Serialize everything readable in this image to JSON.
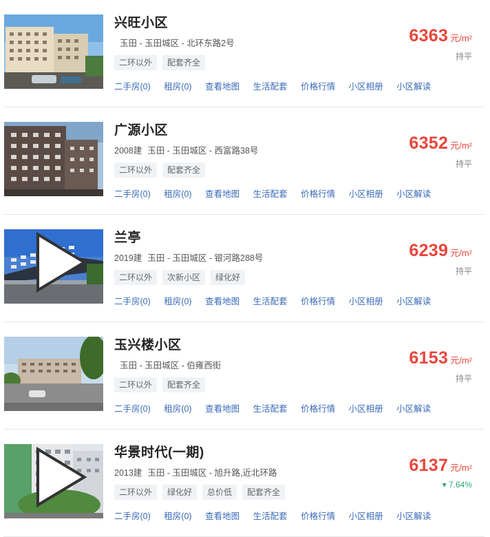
{
  "communities": [
    {
      "name": "兴旺小区",
      "year": "",
      "address": "玉田 - 玉田城区 - 北环东路2号",
      "tags": [
        "二环以外",
        "配套齐全"
      ],
      "price": "6363",
      "unit": "元/m²",
      "trend": "持平",
      "trend_dir": "flat",
      "has_video": false,
      "links": [
        "二手房(0)",
        "租房(0)",
        "查看地图",
        "生活配套",
        "价格行情",
        "小区相册",
        "小区解读"
      ]
    },
    {
      "name": "广源小区",
      "year": "2008建",
      "address": "玉田 - 玉田城区 - 西富路38号",
      "tags": [
        "二环以外",
        "配套齐全"
      ],
      "price": "6352",
      "unit": "元/m²",
      "trend": "持平",
      "trend_dir": "flat",
      "has_video": false,
      "links": [
        "二手房(0)",
        "租房(0)",
        "查看地图",
        "生活配套",
        "价格行情",
        "小区相册",
        "小区解读"
      ]
    },
    {
      "name": "兰亭",
      "year": "2019建",
      "address": "玉田 - 玉田城区 - 银河路288号",
      "tags": [
        "二环以外",
        "次新小区",
        "绿化好"
      ],
      "price": "6239",
      "unit": "元/m²",
      "trend": "持平",
      "trend_dir": "flat",
      "has_video": true,
      "links": [
        "二手房(0)",
        "租房(0)",
        "查看地图",
        "生活配套",
        "价格行情",
        "小区相册",
        "小区解读"
      ]
    },
    {
      "name": "玉兴楼小区",
      "year": "",
      "address": "玉田 - 玉田城区 - 伯雍西街",
      "tags": [
        "二环以外",
        "配套齐全"
      ],
      "price": "6153",
      "unit": "元/m²",
      "trend": "持平",
      "trend_dir": "flat",
      "has_video": false,
      "links": [
        "二手房(0)",
        "租房(0)",
        "查看地图",
        "生活配套",
        "价格行情",
        "小区相册",
        "小区解读"
      ]
    },
    {
      "name": "华景时代(一期)",
      "year": "2013建",
      "address": "玉田 - 玉田城区 - 旭升路,近北环路",
      "tags": [
        "二环以外",
        "绿化好",
        "总价低",
        "配套齐全"
      ],
      "price": "6137",
      "unit": "元/m²",
      "trend": "▾ 7.64%",
      "trend_dir": "up",
      "has_video": true,
      "links": [
        "二手房(0)",
        "租房(0)",
        "查看地图",
        "生活配套",
        "价格行情",
        "小区相册",
        "小区解读"
      ]
    }
  ],
  "colors": {
    "price": "#e9453b",
    "link": "#3a6ab7",
    "trend_up": "#2aa876"
  }
}
